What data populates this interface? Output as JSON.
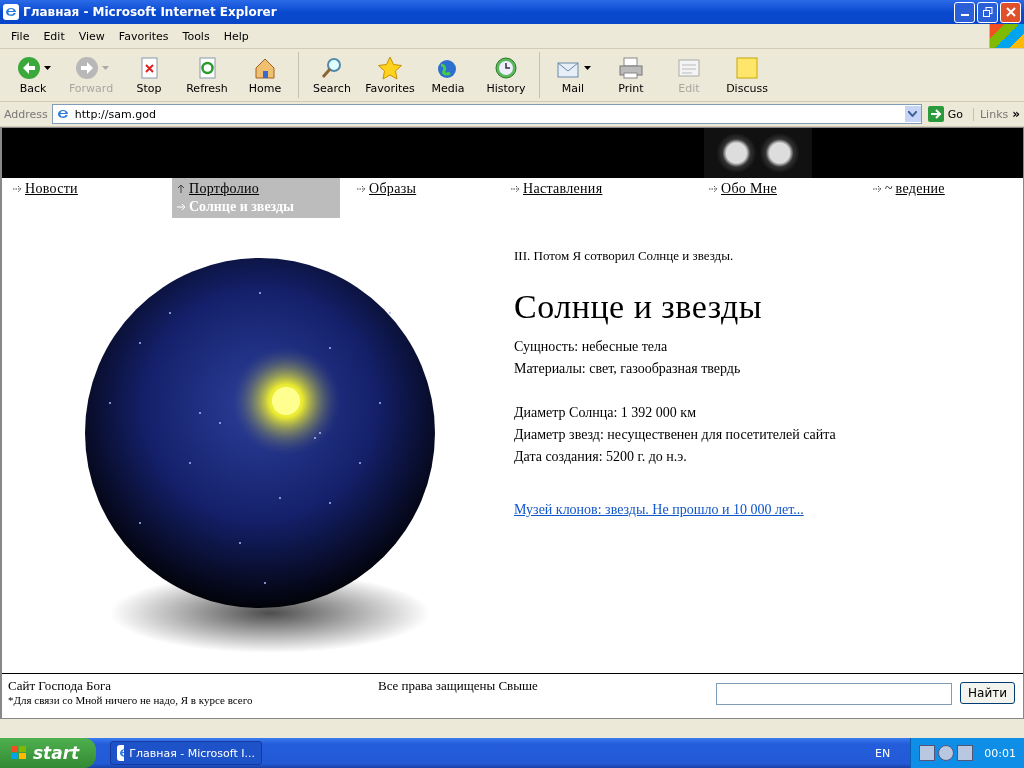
{
  "window": {
    "title": "Главная - Microsoft Internet Explorer"
  },
  "menu": [
    "File",
    "Edit",
    "View",
    "Favorites",
    "Tools",
    "Help"
  ],
  "toolbar": [
    {
      "label": "Back",
      "kind": "back",
      "disabled": false,
      "dropdown": true
    },
    {
      "label": "Forward",
      "kind": "forward",
      "disabled": true,
      "dropdown": true
    },
    {
      "label": "Stop",
      "kind": "stop",
      "disabled": false,
      "dropdown": false
    },
    {
      "label": "Refresh",
      "kind": "refresh",
      "disabled": false,
      "dropdown": false
    },
    {
      "label": "Home",
      "kind": "home",
      "disabled": false,
      "dropdown": false
    },
    {
      "label": "Search",
      "kind": "search",
      "disabled": false,
      "dropdown": false
    },
    {
      "label": "Favorites",
      "kind": "favorites",
      "disabled": false,
      "dropdown": false
    },
    {
      "label": "Media",
      "kind": "media",
      "disabled": false,
      "dropdown": false
    },
    {
      "label": "History",
      "kind": "history",
      "disabled": false,
      "dropdown": false
    },
    {
      "label": "Mail",
      "kind": "mail",
      "disabled": false,
      "dropdown": true
    },
    {
      "label": "Print",
      "kind": "print",
      "disabled": false,
      "dropdown": false
    },
    {
      "label": "Edit",
      "kind": "edit",
      "disabled": true,
      "dropdown": false
    },
    {
      "label": "Discuss",
      "kind": "discuss",
      "disabled": false,
      "dropdown": false
    }
  ],
  "address": {
    "label": "Address",
    "url": "http://sam.god",
    "go": "Go",
    "links": "Links",
    "more": "»"
  },
  "nav": [
    {
      "label": "Новости",
      "selected": false
    },
    {
      "label": "Портфолио",
      "selected": true,
      "children": [
        {
          "label": "Солнце и звезды"
        }
      ]
    },
    {
      "label": "Образы",
      "selected": false
    },
    {
      "label": "Наставления",
      "selected": false
    },
    {
      "label": "Обо Мне",
      "selected": false
    },
    {
      "label": "ведение",
      "selected": false,
      "prefix": "~"
    }
  ],
  "content": {
    "intro": "III. Потом Я сотворил Солнце и звезды.",
    "heading": "Солнце и звезды",
    "groups": [
      [
        "Сущность: небесные тела",
        "Материалы: свет, газообразная твердь"
      ],
      [
        "Диаметр Солнца: 1 392 000 км",
        "Диаметр звезд: несущественен для посетителей сайта",
        "Дата создания: 5200 г. до н.э."
      ]
    ],
    "link": "Музей клонов: звезды. Не прошло и 10 000 лет..."
  },
  "footer": {
    "site": "Сайт Господа Бога",
    "note": "*Для связи со Мной ничего не надо, Я в курсе всего",
    "copyright": "Все права защищены Свыше",
    "search_button": "Найти"
  },
  "taskbar": {
    "start": "start",
    "task": "Главная - Microsoft I...",
    "lang": "EN",
    "time": "00:01"
  }
}
